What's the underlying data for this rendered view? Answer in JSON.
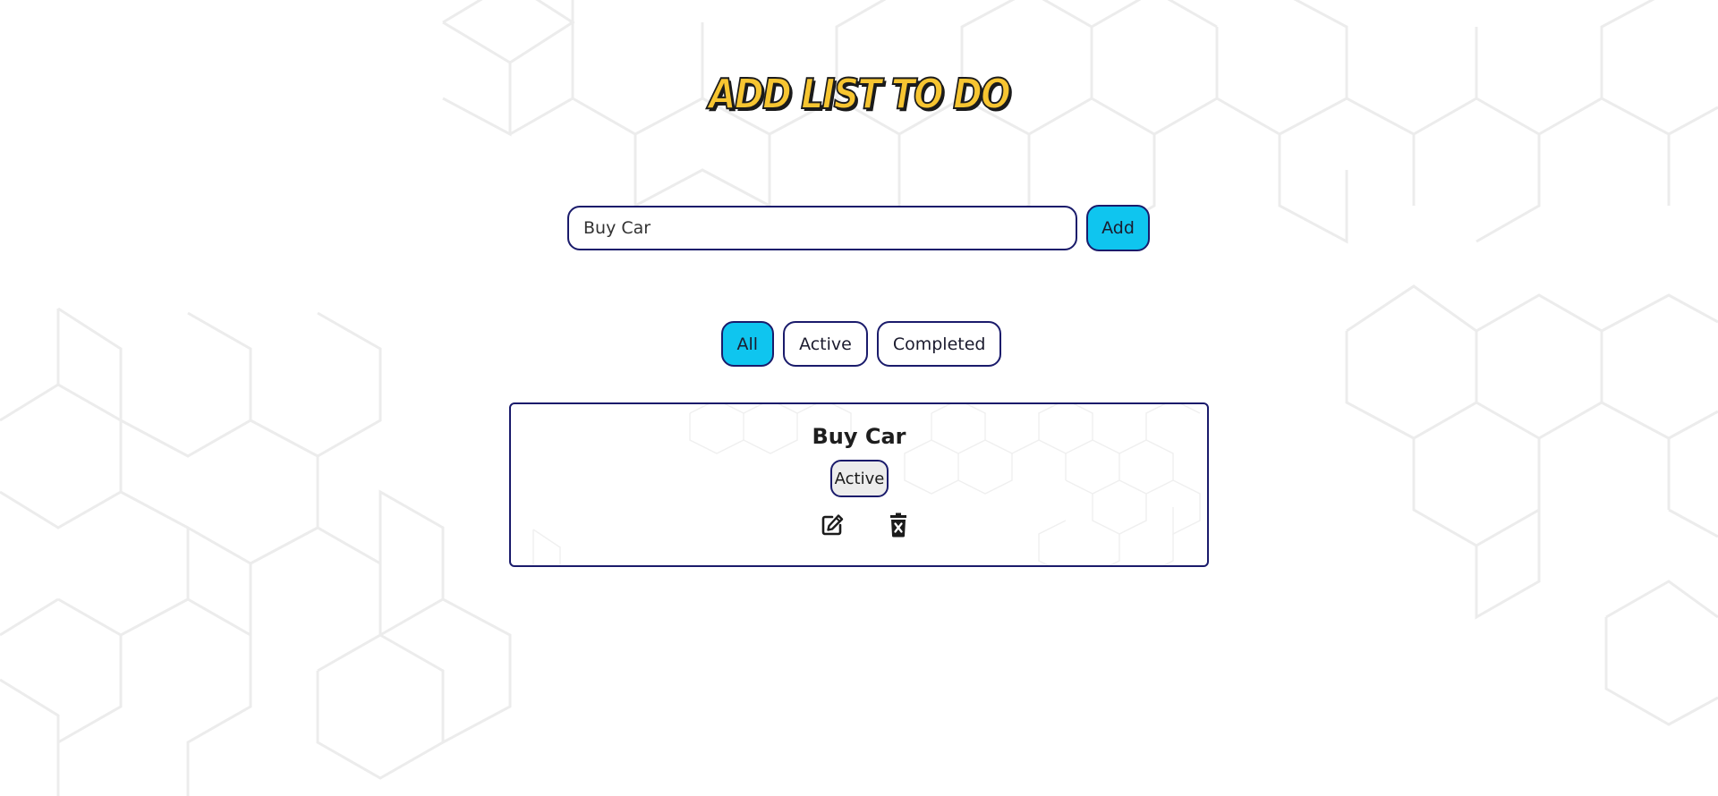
{
  "header": {
    "title": "Add List To Do"
  },
  "add_form": {
    "input_value": "Buy Car",
    "add_label": "Add"
  },
  "filters": {
    "items": [
      {
        "label": "All",
        "selected": true
      },
      {
        "label": "Active",
        "selected": false
      },
      {
        "label": "Completed",
        "selected": false
      }
    ]
  },
  "tasks": [
    {
      "name": "Buy Car",
      "status": "Active",
      "edit_icon": "edit-icon",
      "delete_icon": "trash-icon"
    }
  ],
  "colors": {
    "accent": "#0fc5ef",
    "border": "#1a1b6b",
    "title": "#f7c531",
    "badge_bg": "#ececec"
  }
}
